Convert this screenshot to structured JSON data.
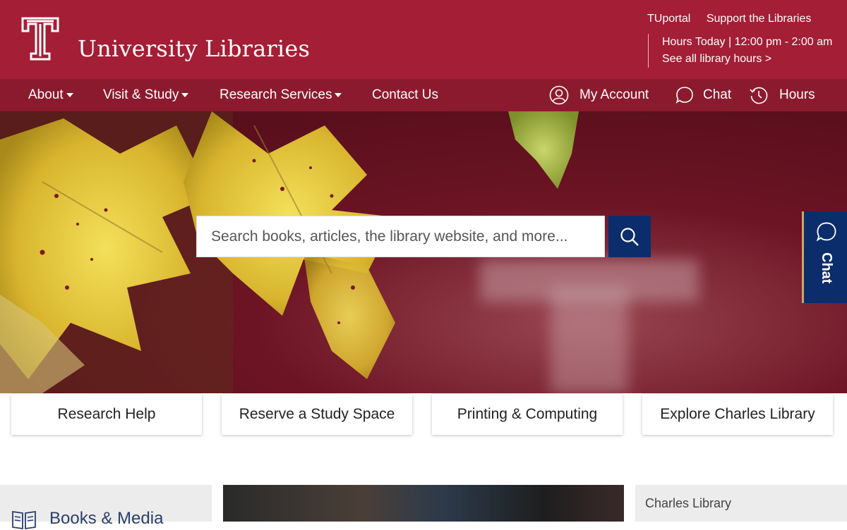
{
  "header": {
    "site_title": "University Libraries",
    "util_links": [
      "TUportal",
      "Support the Libraries"
    ],
    "hours_today": "Hours Today | 12:00 pm - 2:00 am",
    "see_all_hours": "See all library hours >"
  },
  "nav": {
    "about": "About",
    "visit_study": "Visit & Study",
    "research_services": "Research Services",
    "contact_us": "Contact Us",
    "my_account": "My Account",
    "chat": "Chat",
    "hours": "Hours"
  },
  "search": {
    "placeholder": "Search books, articles, the library website, and more..."
  },
  "chat_tab": {
    "label": "Chat"
  },
  "quick_links": [
    "Research Help",
    "Reserve a Study Space",
    "Printing & Computing",
    "Explore Charles Library"
  ],
  "sections": {
    "books_media": "Books & Media",
    "charles_library": "Charles Library"
  },
  "colors": {
    "brand": "#a41e35",
    "nav": "#8c1a2e",
    "accent_blue": "#0c2d6b"
  }
}
